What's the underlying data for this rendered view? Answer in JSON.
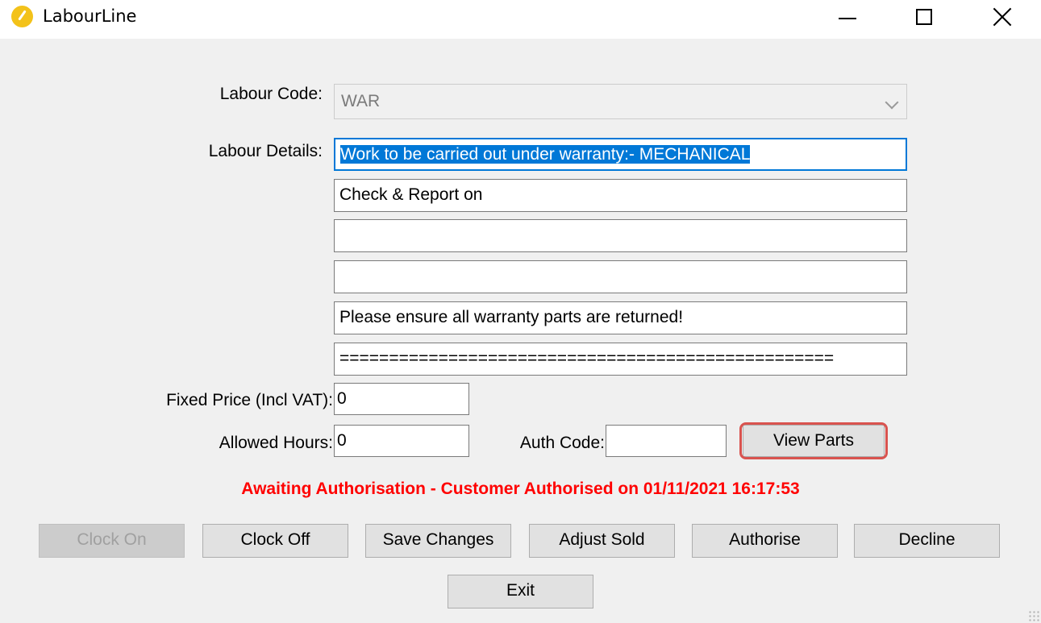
{
  "window": {
    "title": "LabourLine",
    "app_icon": "labourline-app-icon",
    "controls": [
      "minimize-icon",
      "maximize-icon",
      "close-icon"
    ]
  },
  "form": {
    "labour_code_label": "Labour Code:",
    "labour_code_value": "WAR",
    "labour_details_label": "Labour Details:",
    "labour_details": [
      "Work to be carried out under warranty:- MECHANICAL",
      "Check & Report on",
      "",
      "",
      "Please ensure all warranty parts are returned!",
      "=================================================="
    ],
    "fixed_price_label": "Fixed Price (Incl VAT):",
    "fixed_price_value": "0",
    "allowed_hours_label": "Allowed Hours:",
    "allowed_hours_value": "0",
    "auth_code_label": "Auth Code:",
    "auth_code_value": "",
    "view_parts_label": "View Parts"
  },
  "status": {
    "text": "Awaiting Authorisation - Customer Authorised on 01/11/2021 16:17:53",
    "color": "#ff0000"
  },
  "buttons": {
    "clock_on": "Clock On",
    "clock_off": "Clock Off",
    "save_changes": "Save Changes",
    "adjust_sold": "Adjust Sold",
    "authorise": "Authorise",
    "decline": "Decline",
    "exit": "Exit"
  },
  "colors": {
    "accent": "#0078d7",
    "highlight_ring": "#d9534f",
    "window_bg": "#f0f0f0"
  }
}
